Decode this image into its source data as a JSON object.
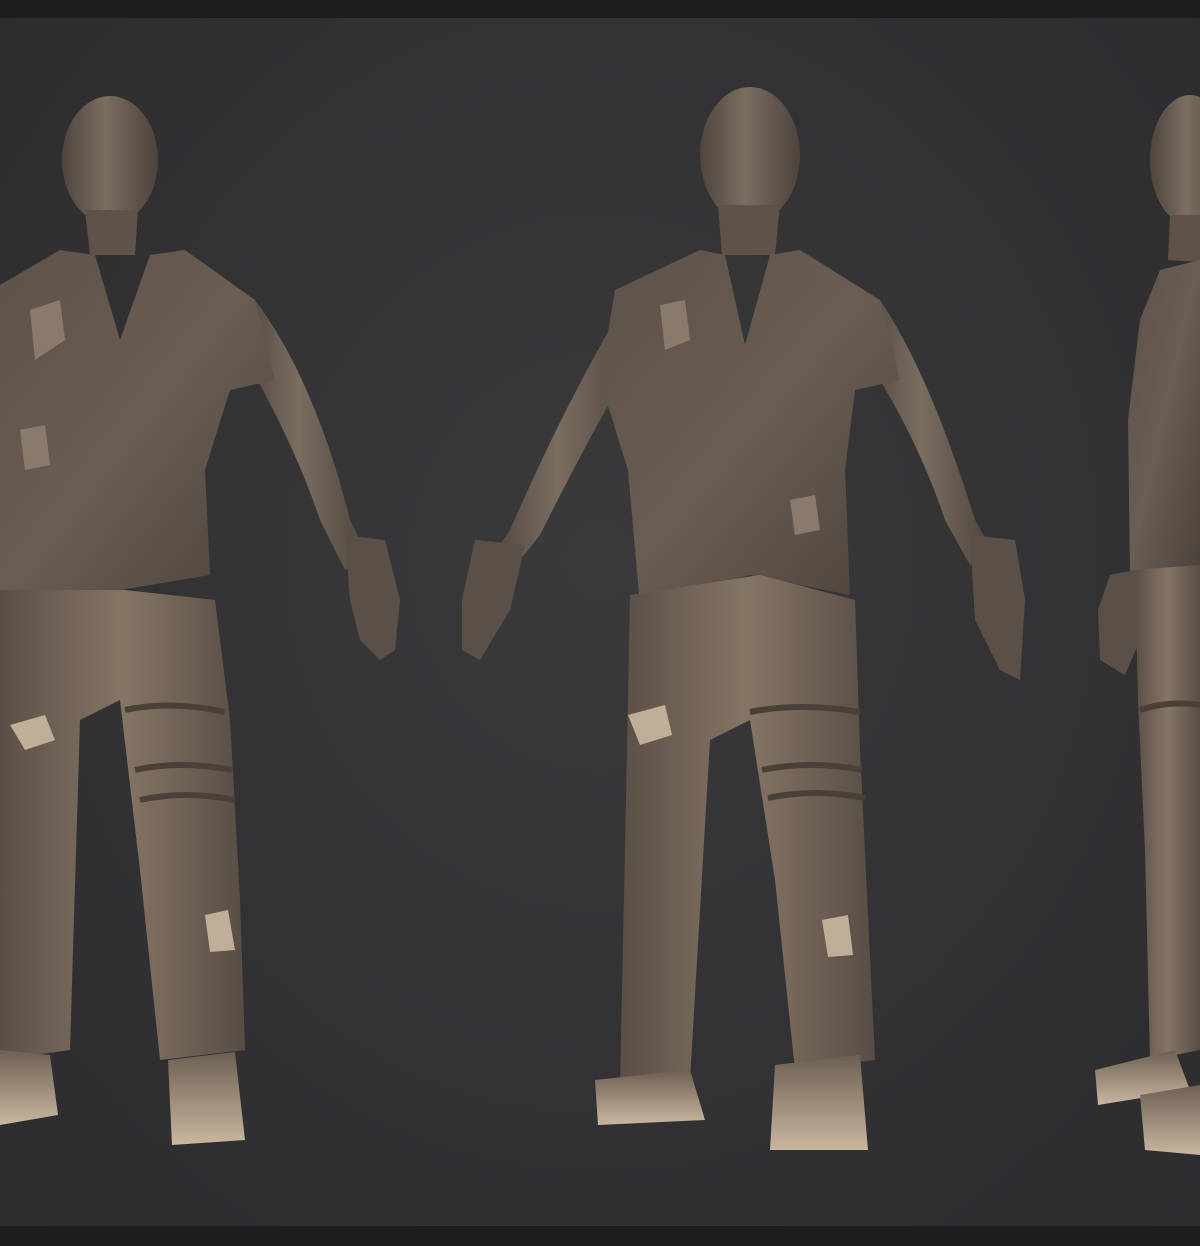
{
  "scene": {
    "description_label": "",
    "background_color": "#333336",
    "frame_color": "#1d1d1f",
    "clay_color": "#6e6257",
    "clay_light": "#8d7d6e",
    "clay_dark": "#4a4038",
    "patch_color": "#bfae98",
    "figures": [
      {
        "name": "figure-front-view"
      },
      {
        "name": "figure-three-quarter-view"
      },
      {
        "name": "figure-side-view"
      }
    ]
  }
}
